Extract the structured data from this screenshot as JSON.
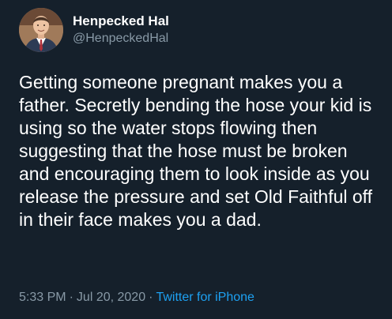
{
  "author": {
    "display_name": "Henpecked Hal",
    "handle": "@HenpeckedHal",
    "avatar_icon": "profile-photo-man-in-suit"
  },
  "tweet": {
    "text": "Getting someone pregnant makes you a father. Secretly bending the hose your kid is using so the water stops flowing then suggesting that the hose must be broken and encouraging them to look inside as you release the pressure and set Old Faithful off in their face makes you a dad.",
    "time": "5:33 PM",
    "date": "Jul 20, 2020",
    "separator": "·",
    "source": "Twitter for iPhone"
  },
  "colors": {
    "background": "#15202b",
    "text_primary": "#ffffff",
    "text_secondary": "#8899a6",
    "link": "#1da1f2"
  }
}
